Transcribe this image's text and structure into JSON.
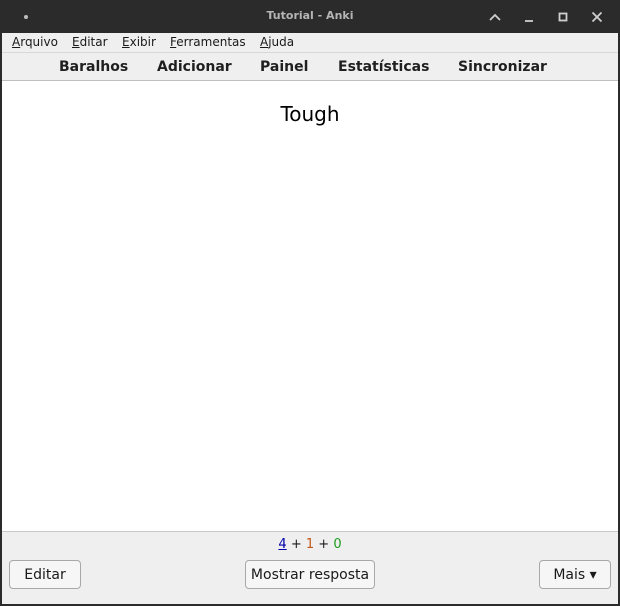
{
  "window": {
    "title": "Tutorial - Anki"
  },
  "menubar": {
    "items": [
      {
        "label": "Arquivo"
      },
      {
        "label": "Editar"
      },
      {
        "label": "Exibir"
      },
      {
        "label": "Ferramentas"
      },
      {
        "label": "Ajuda"
      }
    ]
  },
  "toolbar": {
    "items": [
      {
        "label": "Baralhos"
      },
      {
        "label": "Adicionar"
      },
      {
        "label": "Painel"
      },
      {
        "label": "Estatísticas"
      },
      {
        "label": "Sincronizar"
      }
    ]
  },
  "card": {
    "question": "Tough"
  },
  "counts": {
    "new": "4",
    "learning": "1",
    "review": "0",
    "separator": "+",
    "colors": {
      "new": "#0000aa",
      "learning": "#c35617",
      "review": "#1c9d1c"
    }
  },
  "bottom": {
    "edit_label": "Editar",
    "show_answer_label": "Mostrar resposta",
    "more_label": "Mais ▾"
  }
}
